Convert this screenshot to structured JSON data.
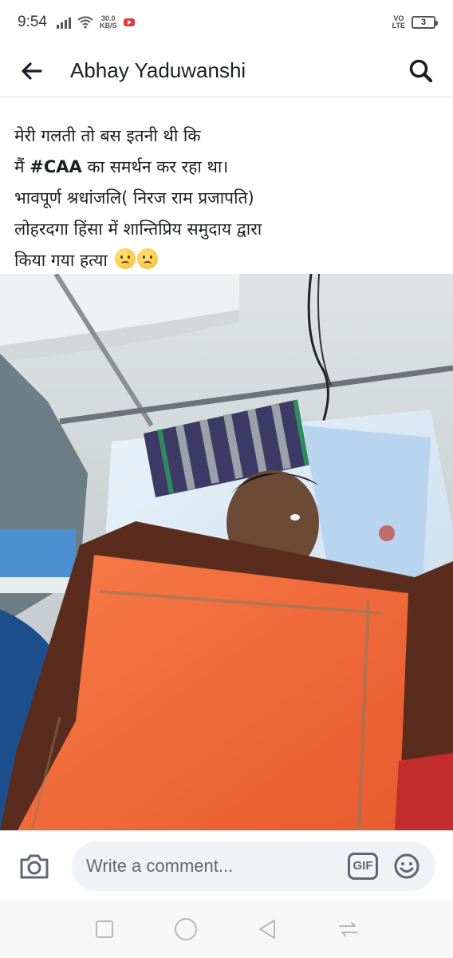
{
  "status_bar": {
    "time": "9:54",
    "net_speed_value": "30.0",
    "net_speed_unit": "KB/S",
    "volte_top": "VO",
    "volte_bottom": "LTE",
    "battery_level": "3"
  },
  "header": {
    "title": "Abhay Yaduwanshi"
  },
  "post": {
    "lines": [
      "मेरी गलती तो बस इतनी थी कि",
      "मैं",
      "का समर्थन कर  रहा था।",
      "भावपूर्ण श्रधांजलि( निरज राम प्रजापति)",
      "लोहरदगा हिंसा में शान्तिप्रिय समुदाय द्वारा",
      "किया गया हत्या"
    ],
    "hashtag": "#CAA"
  },
  "comment_bar": {
    "placeholder": "Write a comment...",
    "gif_label": "GIF"
  },
  "colors": {
    "text": "#1c1e21",
    "muted": "#65676b",
    "input_bg": "#f0f2f5",
    "blanket": "#f26a3c"
  }
}
